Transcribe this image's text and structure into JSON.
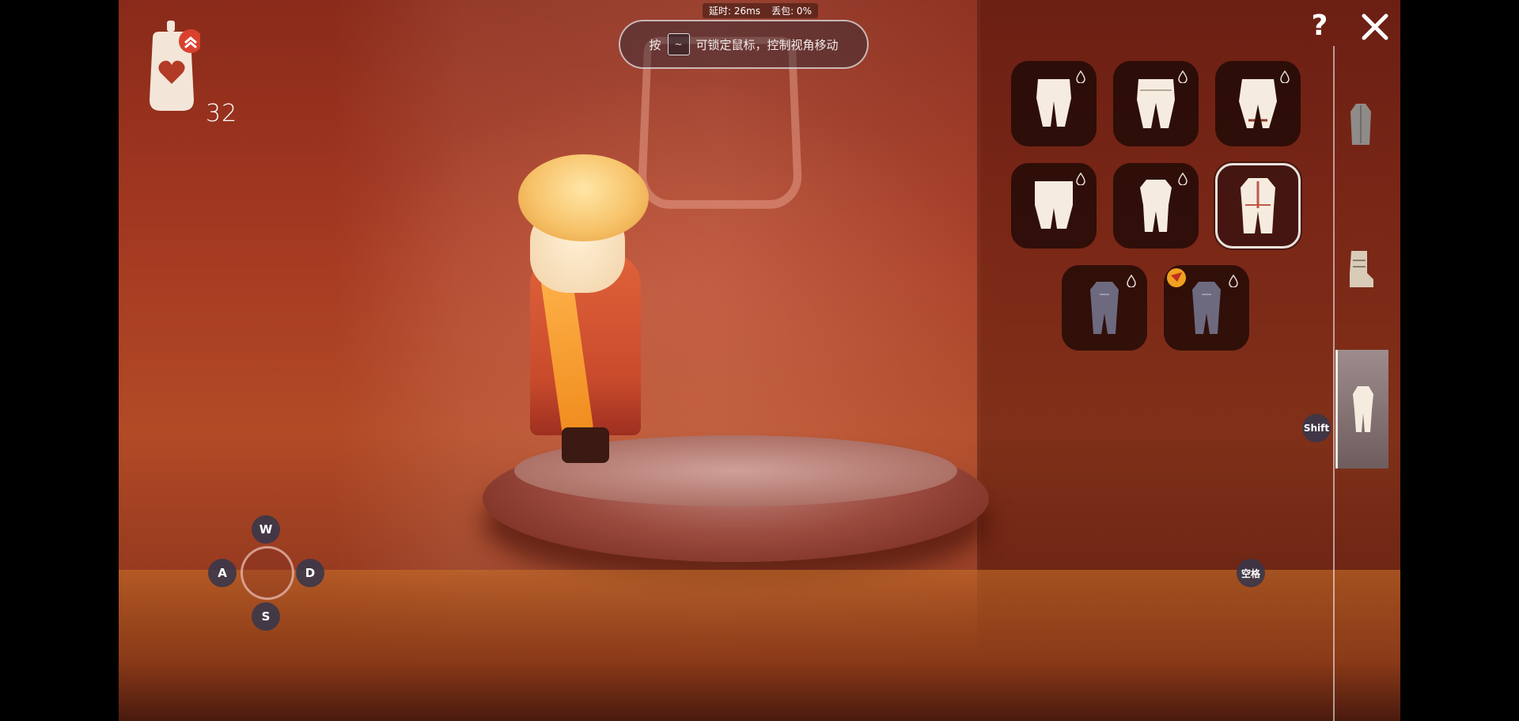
{
  "top_stats": {
    "latency_label": "延时: 26ms",
    "packet_loss_label": "丢包: 0%"
  },
  "hint": {
    "prefix": "按",
    "key": "~",
    "suffix": "可锁定鼠标，控制视角移动"
  },
  "candles": {
    "icon": "heart-candle-icon",
    "count": "32"
  },
  "header_icons": {
    "help": "?",
    "close": "close-icon"
  },
  "wardrobe": {
    "items": [
      {
        "icon": "pants-icon",
        "currency_icon": "drop-icon"
      },
      {
        "icon": "pants-icon",
        "currency_icon": "drop-icon"
      },
      {
        "icon": "pants-icon",
        "currency_icon": "drop-icon"
      },
      {
        "icon": "pants-icon",
        "currency_icon": "drop-icon"
      },
      {
        "icon": "outfit-icon",
        "currency_icon": "drop-icon"
      },
      {
        "icon": "outfit-icon",
        "selected": true
      },
      {
        "icon": "outfit-icon",
        "currency_icon": "drop-icon"
      },
      {
        "icon": "outfit-icon",
        "currency_icon": "drop-icon",
        "badge_icon": "season-badge-icon"
      }
    ],
    "tabs": [
      {
        "icon": "cape-tab-icon"
      },
      {
        "icon": "shoe-tab-icon"
      },
      {
        "icon": "outfit-tab-icon",
        "active": true
      }
    ]
  },
  "keys": {
    "up": "W",
    "left": "A",
    "right": "D",
    "down": "S",
    "shift": "Shift",
    "space": "空格"
  }
}
